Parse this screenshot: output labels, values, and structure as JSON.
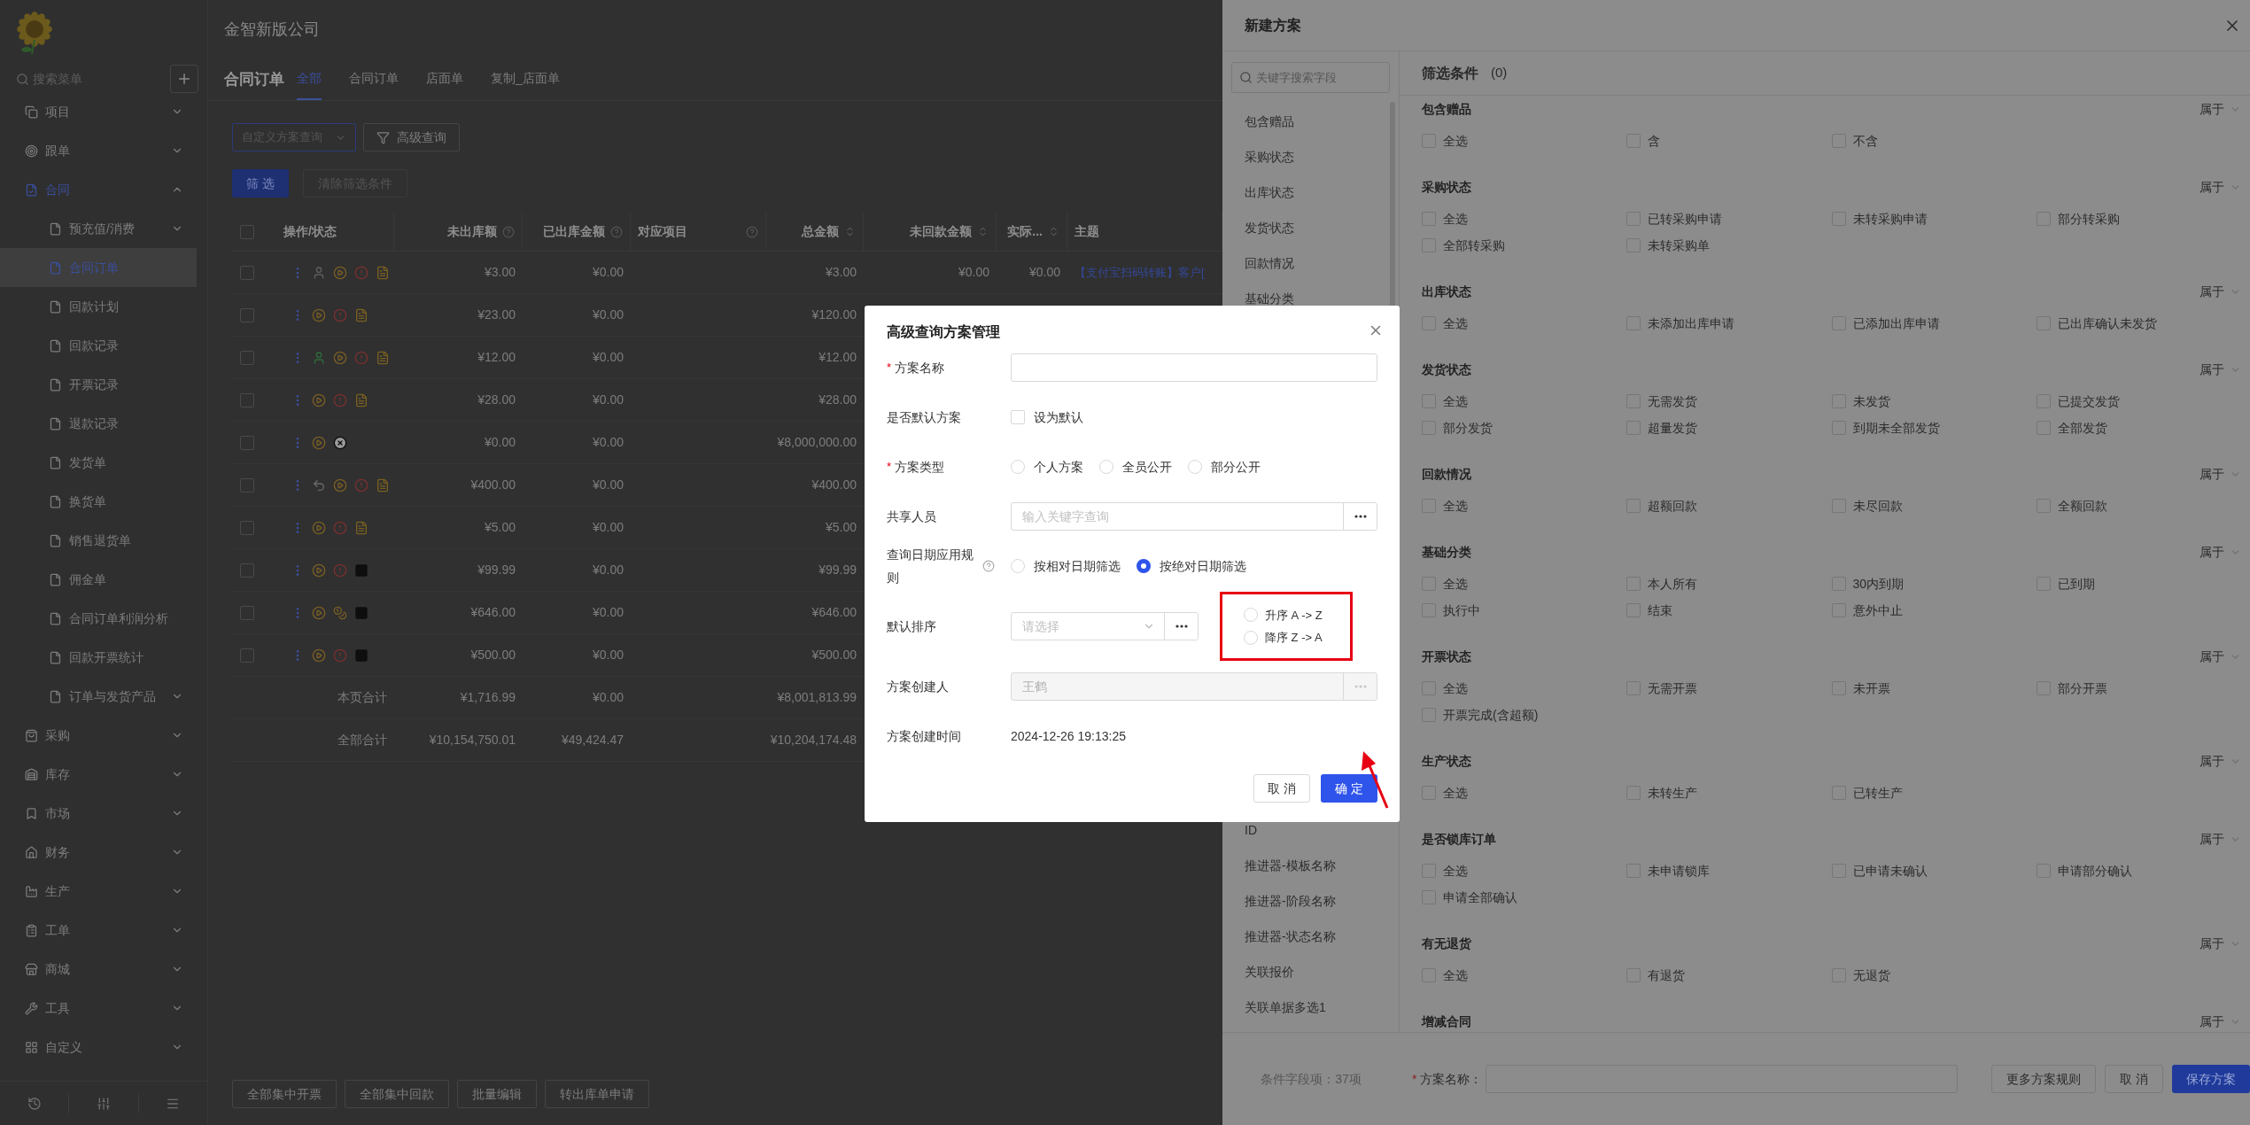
{
  "sidebar": {
    "search": {
      "placeholder": "搜索菜单"
    },
    "items": [
      {
        "label": "项目",
        "expanded": false,
        "selected": false
      },
      {
        "label": "跟单",
        "expanded": false,
        "selected": false
      },
      {
        "label": "合同",
        "expanded": true,
        "selected": false,
        "children": [
          {
            "label": "预充值/消费",
            "expanded": false,
            "selected": false
          },
          {
            "label": "合同订单",
            "selected": true
          },
          {
            "label": "回款计划",
            "selected": false
          },
          {
            "label": "回款记录",
            "selected": false
          },
          {
            "label": "开票记录",
            "selected": false
          },
          {
            "label": "退款记录",
            "selected": false
          },
          {
            "label": "发货单",
            "selected": false
          },
          {
            "label": "换货单",
            "selected": false
          },
          {
            "label": "销售退货单",
            "selected": false
          },
          {
            "label": "佣金单",
            "selected": false
          },
          {
            "label": "合同订单利润分析",
            "selected": false
          },
          {
            "label": "回款开票统计",
            "selected": false
          },
          {
            "label": "订单与发货产品",
            "expanded": false,
            "selected": false
          }
        ]
      },
      {
        "label": "采购",
        "expanded": false,
        "selected": false
      },
      {
        "label": "库存",
        "expanded": false,
        "selected": false
      },
      {
        "label": "市场",
        "expanded": false,
        "selected": false
      },
      {
        "label": "财务",
        "expanded": false,
        "selected": false
      },
      {
        "label": "生产",
        "expanded": false,
        "selected": false
      },
      {
        "label": "工单",
        "expanded": false,
        "selected": false
      },
      {
        "label": "商城",
        "expanded": false,
        "selected": false
      },
      {
        "label": "工具",
        "expanded": false,
        "selected": false
      },
      {
        "label": "自定义",
        "expanded": false,
        "selected": false
      }
    ]
  },
  "main": {
    "company": "金智新版公司",
    "page_title": "合同订单",
    "tabs": [
      {
        "label": "全部",
        "selected": true
      },
      {
        "label": "合同订单",
        "selected": false
      },
      {
        "label": "店面单",
        "selected": false
      },
      {
        "label": "复制_店面单",
        "selected": false
      }
    ],
    "scheme_select": {
      "placeholder": "自定义方案查询"
    },
    "advanced_button": "高级查询",
    "filter_button": "筛 选",
    "clear_button": {
      "label": "清除筛选条件",
      "disabled": true
    },
    "table": {
      "all_checked": false,
      "columns": [
        {
          "label": "操作/状态",
          "help": false,
          "sortable": false
        },
        {
          "label": "未出库额",
          "help": true,
          "sortable": false
        },
        {
          "label": "已出库金额",
          "help": true,
          "sortable": false
        },
        {
          "label": "对应项目",
          "help": true,
          "sortable": false
        },
        {
          "label": "总金额",
          "help": false,
          "sortable": true
        },
        {
          "label": "未回款金额",
          "help": false,
          "sortable": true
        },
        {
          "label": "实际...",
          "help": false,
          "sortable": true
        },
        {
          "label": "主题",
          "help": false,
          "sortable": false
        }
      ],
      "rows": [
        {
          "checked": false,
          "icons": [
            {
              "kind": "person",
              "color": "#5e5e5e"
            },
            {
              "kind": "play"
            },
            {
              "kind": "alert"
            },
            {
              "kind": "doc"
            }
          ],
          "unshipped": "¥3.00",
          "shipped": "¥0.00",
          "total": "¥3.00",
          "unpaid": "¥0.00",
          "actual": "¥0.00",
          "subject": "【支付宝扫码转账】客户["
        },
        {
          "checked": false,
          "icons": [
            {
              "kind": "play"
            },
            {
              "kind": "alert"
            },
            {
              "kind": "doc"
            }
          ],
          "unshipped": "¥23.00",
          "shipped": "¥0.00",
          "total": "¥120.00"
        },
        {
          "checked": false,
          "icons": [
            {
              "kind": "person",
              "color": "#2e6b3c"
            },
            {
              "kind": "play"
            },
            {
              "kind": "alert"
            },
            {
              "kind": "doc"
            }
          ],
          "unshipped": "¥12.00",
          "shipped": "¥0.00",
          "total": "¥12.00"
        },
        {
          "checked": false,
          "icons": [
            {
              "kind": "play"
            },
            {
              "kind": "alert"
            },
            {
              "kind": "doc"
            }
          ],
          "unshipped": "¥28.00",
          "shipped": "¥0.00",
          "total": "¥28.00"
        },
        {
          "checked": false,
          "icons": [
            {
              "kind": "play"
            },
            {
              "kind": "cross"
            }
          ],
          "unshipped": "¥0.00",
          "shipped": "¥0.00",
          "total": "¥8,000,000.00"
        },
        {
          "checked": false,
          "icons": [
            {
              "kind": "undo"
            },
            {
              "kind": "play"
            },
            {
              "kind": "alert"
            },
            {
              "kind": "doc"
            }
          ],
          "unshipped": "¥400.00",
          "shipped": "¥0.00",
          "total": "¥400.00"
        },
        {
          "checked": false,
          "icons": [
            {
              "kind": "play"
            },
            {
              "kind": "alert"
            },
            {
              "kind": "doc"
            }
          ],
          "unshipped": "¥5.00",
          "shipped": "¥0.00",
          "total": "¥5.00"
        },
        {
          "checked": false,
          "icons": [
            {
              "kind": "play"
            },
            {
              "kind": "alert"
            },
            {
              "kind": "square"
            }
          ],
          "unshipped": "¥99.99",
          "shipped": "¥0.00",
          "total": "¥99.99"
        },
        {
          "checked": false,
          "icons": [
            {
              "kind": "play"
            },
            {
              "kind": "coin"
            },
            {
              "kind": "square"
            }
          ],
          "unshipped": "¥646.00",
          "shipped": "¥0.00",
          "total": "¥646.00"
        },
        {
          "checked": false,
          "icons": [
            {
              "kind": "play"
            },
            {
              "kind": "alert"
            },
            {
              "kind": "square"
            }
          ],
          "unshipped": "¥500.00",
          "shipped": "¥0.00",
          "total": "¥500.00"
        }
      ],
      "totals": [
        {
          "label": "本页合计",
          "unshipped": "¥1,716.99",
          "shipped": "¥0.00",
          "total": "¥8,001,813.99"
        },
        {
          "label": "全部合计",
          "unshipped": "¥10,154,750.01",
          "shipped": "¥49,424.47",
          "total": "¥10,204,174.48"
        }
      ]
    },
    "bottom_buttons": [
      "全部集中开票",
      "全部集中回款",
      "批量编辑",
      "转出库单申请"
    ]
  },
  "drawer": {
    "title": "新建方案",
    "field_search": {
      "placeholder": "关键字搜索字段"
    },
    "fields_top": [
      "包含赠品",
      "采购状态",
      "出库状态",
      "发货状态",
      "回款情况",
      "基础分类"
    ],
    "fields_bottom": [
      "ID",
      "推进器-模板名称",
      "推进器-阶段名称",
      "推进器-状态名称",
      "关联报价",
      "关联单据多选1"
    ],
    "field_count": "条件字段项：37项",
    "filter_title": "筛选条件",
    "filter_count": "(0)",
    "groups": [
      {
        "title": "包含赠品",
        "operator": "属于",
        "options": [
          {
            "label": "全选",
            "checked": false
          },
          {
            "label": "含",
            "checked": false
          },
          {
            "label": "不含",
            "checked": false
          }
        ]
      },
      {
        "title": "采购状态",
        "operator": "属于",
        "options": [
          {
            "label": "全选",
            "checked": false
          },
          {
            "label": "已转采购申请",
            "checked": false
          },
          {
            "label": "未转采购申请",
            "checked": false
          },
          {
            "label": "部分转采购",
            "checked": false
          },
          {
            "label": "全部转采购",
            "checked": false
          },
          {
            "label": "未转采购单",
            "checked": false
          }
        ]
      },
      {
        "title": "出库状态",
        "operator": "属于",
        "options": [
          {
            "label": "全选",
            "checked": false
          },
          {
            "label": "未添加出库申请",
            "checked": false
          },
          {
            "label": "已添加出库申请",
            "checked": false
          },
          {
            "label": "已出库确认未发货",
            "checked": false
          }
        ]
      },
      {
        "title": "发货状态",
        "operator": "属于",
        "options": [
          {
            "label": "全选",
            "checked": false
          },
          {
            "label": "无需发货",
            "checked": false
          },
          {
            "label": "未发货",
            "checked": false
          },
          {
            "label": "已提交发货",
            "checked": false
          },
          {
            "label": "部分发货",
            "checked": false
          },
          {
            "label": "超量发货",
            "checked": false
          },
          {
            "label": "到期未全部发货",
            "checked": false
          },
          {
            "label": "全部发货",
            "checked": false
          }
        ]
      },
      {
        "title": "回款情况",
        "operator": "属于",
        "options": [
          {
            "label": "全选",
            "checked": false
          },
          {
            "label": "超额回款",
            "checked": false
          },
          {
            "label": "未尽回款",
            "checked": false
          },
          {
            "label": "全额回款",
            "checked": false
          }
        ]
      },
      {
        "title": "基础分类",
        "operator": "属于",
        "options": [
          {
            "label": "全选",
            "checked": false
          },
          {
            "label": "本人所有",
            "checked": false
          },
          {
            "label": "30内到期",
            "checked": false
          },
          {
            "label": "已到期",
            "checked": false
          },
          {
            "label": "执行中",
            "checked": false
          },
          {
            "label": "结束",
            "checked": false
          },
          {
            "label": "意外中止",
            "checked": false
          }
        ]
      },
      {
        "title": "开票状态",
        "operator": "属于",
        "options": [
          {
            "label": "全选",
            "checked": false
          },
          {
            "label": "无需开票",
            "checked": false
          },
          {
            "label": "未开票",
            "checked": false
          },
          {
            "label": "部分开票",
            "checked": false
          },
          {
            "label": "开票完成(含超额)",
            "checked": false
          }
        ]
      },
      {
        "title": "生产状态",
        "operator": "属于",
        "options": [
          {
            "label": "全选",
            "checked": false
          },
          {
            "label": "未转生产",
            "checked": false
          },
          {
            "label": "已转生产",
            "checked": false
          }
        ]
      },
      {
        "title": "是否锁库订单",
        "operator": "属于",
        "options": [
          {
            "label": "全选",
            "checked": false
          },
          {
            "label": "未申请锁库",
            "checked": false
          },
          {
            "label": "已申请未确认",
            "checked": false
          },
          {
            "label": "申请部分确认",
            "checked": false
          },
          {
            "label": "申请全部确认",
            "checked": false
          }
        ]
      },
      {
        "title": "有无退货",
        "operator": "属于",
        "options": [
          {
            "label": "全选",
            "checked": false
          },
          {
            "label": "有退货",
            "checked": false
          },
          {
            "label": "无退货",
            "checked": false
          }
        ]
      },
      {
        "title": "增减合同",
        "operator": "属于"
      }
    ],
    "footer": {
      "name_label": "方案名称：",
      "required": true,
      "required_mark": "*",
      "buttons": [
        {
          "label": "更多方案规则",
          "primary": false
        },
        {
          "label": "取 消",
          "primary": false
        },
        {
          "label": "保存方案",
          "primary": true
        }
      ]
    }
  },
  "modal": {
    "title": "高级查询方案管理",
    "required_mark": "*",
    "fields": [
      {
        "kind": "input",
        "label": "方案名称",
        "required": true,
        "help": false
      },
      {
        "kind": "checkbox",
        "label": "是否默认方案",
        "required": false,
        "help": false,
        "option": "设为默认",
        "checked": false
      },
      {
        "kind": "radio",
        "label": "方案类型",
        "required": true,
        "help": false,
        "options": [
          {
            "label": "个人方案",
            "selected": false
          },
          {
            "label": "全员公开",
            "selected": false
          },
          {
            "label": "部分公开",
            "selected": false
          }
        ]
      },
      {
        "kind": "picker",
        "label": "共享人员",
        "required": false,
        "help": false,
        "placeholder": "输入关键字查询",
        "disabled": false
      },
      {
        "kind": "radio",
        "label": "查询日期应用规则",
        "required": false,
        "help": true,
        "options": [
          {
            "label": "按相对日期筛选",
            "selected": false
          },
          {
            "label": "按绝对日期筛选",
            "selected": true
          }
        ]
      },
      {
        "kind": "sort",
        "label": "默认排序",
        "required": false,
        "help": false,
        "placeholder": "请选择",
        "highlighted": true,
        "options": [
          {
            "label": "升序 A -> Z",
            "selected": false
          },
          {
            "label": "降序 Z -> A",
            "selected": false
          }
        ]
      },
      {
        "kind": "picker",
        "label": "方案创建人",
        "required": false,
        "help": false,
        "value": "王鹤",
        "disabled": true
      },
      {
        "kind": "text",
        "label": "方案创建时间",
        "required": false,
        "help": false,
        "value": "2024-12-26 19:13:25"
      }
    ],
    "buttons": [
      {
        "label": "取 消",
        "primary": false
      },
      {
        "label": "确 定",
        "primary": true
      }
    ],
    "arrow_annotation": true
  }
}
